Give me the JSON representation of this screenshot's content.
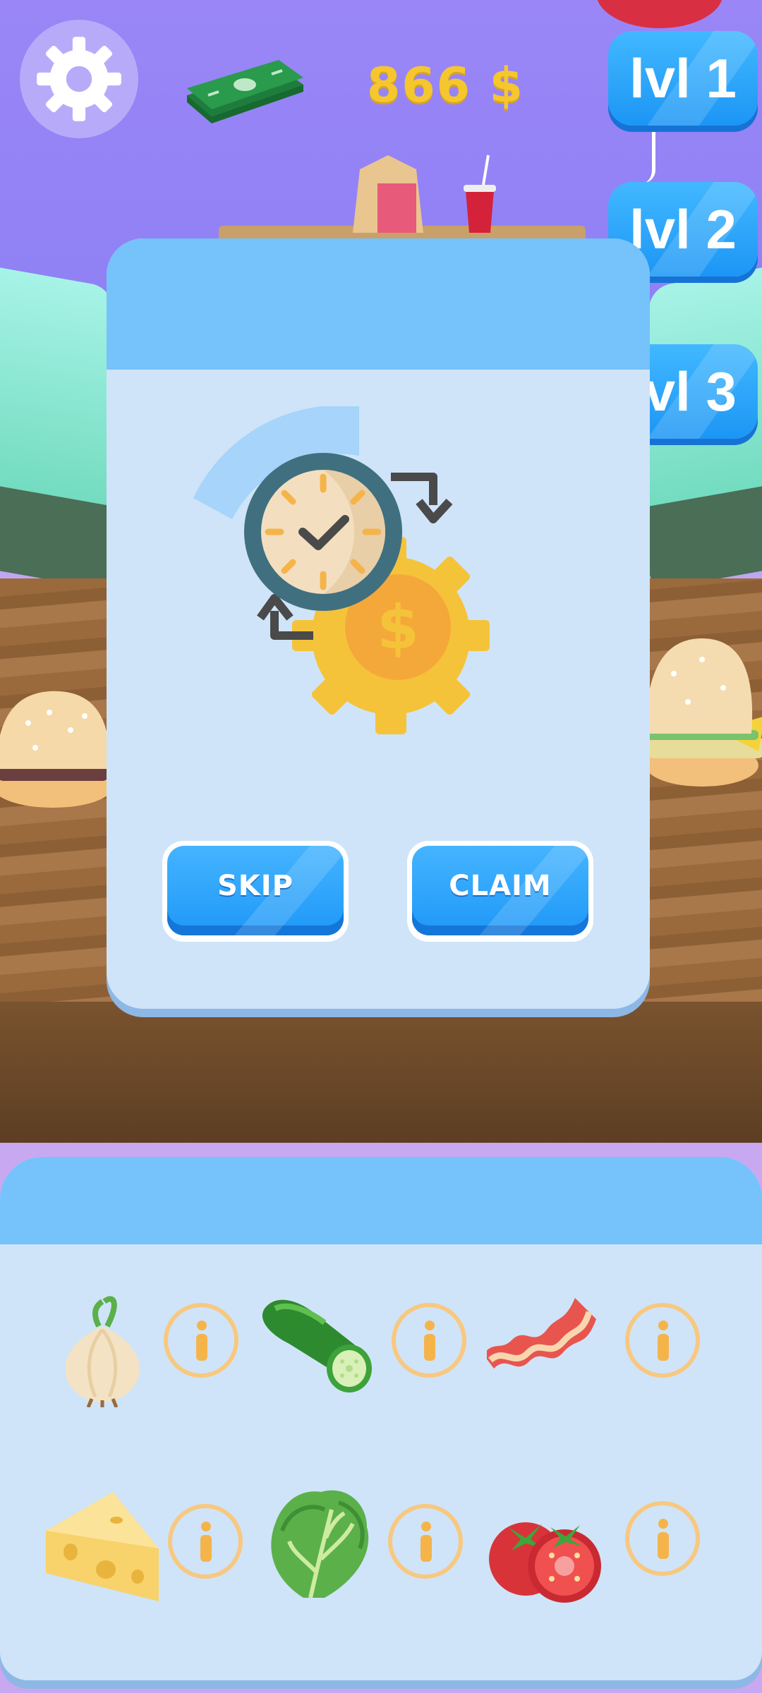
{
  "hud": {
    "settings_icon": "gear-icon",
    "money_icon": "cash-stack-icon",
    "money": "866 $"
  },
  "levels": [
    {
      "label": "lvl 1"
    },
    {
      "label": "lvl 2"
    },
    {
      "label": "lvl 3"
    }
  ],
  "dialog": {
    "graphic_icon": "clock-gear-money-icon",
    "skip_label": "SKIP",
    "claim_label": "CLAIM"
  },
  "ingredients": [
    {
      "name": "onion",
      "icon": "onion-icon"
    },
    {
      "name": "cucumber",
      "icon": "cucumber-icon"
    },
    {
      "name": "bacon",
      "icon": "bacon-icon"
    },
    {
      "name": "cheese",
      "icon": "cheese-icon"
    },
    {
      "name": "lettuce",
      "icon": "lettuce-icon"
    },
    {
      "name": "tomato",
      "icon": "tomato-icon"
    }
  ],
  "colors": {
    "accent_blue": "#1e98f7",
    "panel_bg": "#cfe4f8",
    "header_blue": "#76c2fb",
    "money_yellow": "#f5c62e",
    "info_orange": "#f5b44a"
  }
}
